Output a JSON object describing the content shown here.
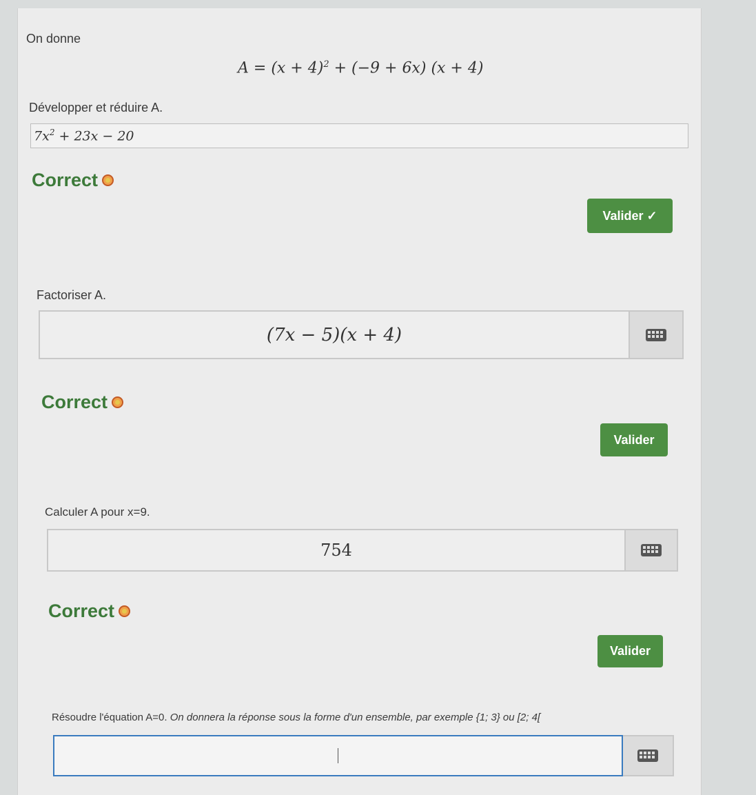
{
  "intro": "On donne",
  "expression": {
    "lhs": "A",
    "rhs_part1": "(x + 4)",
    "rhs_exp": "2",
    "rhs_part2": " + (−9 + 6x) (x + 4)"
  },
  "q1": {
    "prompt": "Développer et réduire A.",
    "answer_main": "7x",
    "answer_exp": "2",
    "answer_rest": " + 23x − 20",
    "feedback": "Correct",
    "button": "Valider ✓"
  },
  "q2": {
    "prompt": "Factoriser A.",
    "answer": "(7x − 5)(x + 4)",
    "feedback": "Correct",
    "button": "Valider"
  },
  "q3": {
    "prompt": "Calculer A pour x=9.",
    "answer": "754",
    "feedback": "Correct",
    "button": "Valider"
  },
  "q4": {
    "prompt_start": "Résoudre l'équation A=0. ",
    "prompt_italic": "On donnera la réponse sous la forme d'un ensemble, par exemple {1; 3} ou [2; 4[",
    "answer": ""
  },
  "icons": {
    "feedback": "smiley-icon",
    "keyboard": "keyboard-icon"
  },
  "colors": {
    "correct_text": "#3d7a3a",
    "button_bg": "#4d8f43",
    "active_border": "#3a7bbf"
  }
}
